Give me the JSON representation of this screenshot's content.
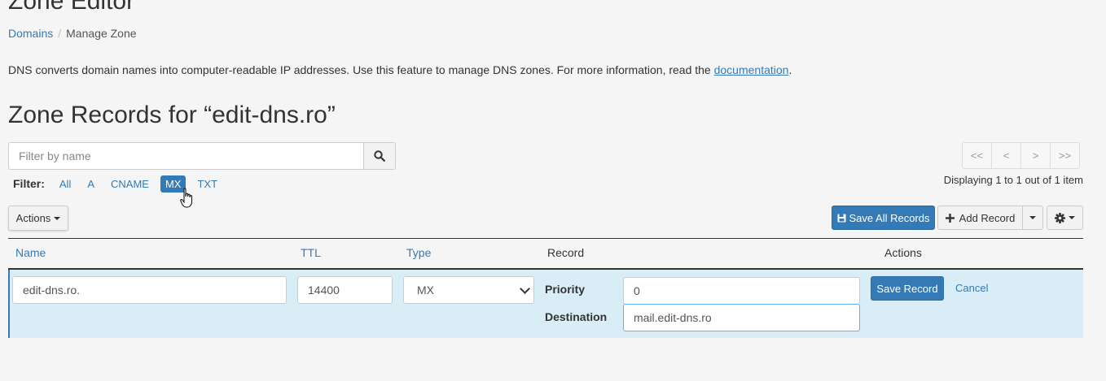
{
  "page": {
    "title": "Zone Editor",
    "breadcrumb": {
      "parent": "Domains",
      "separator": "/",
      "current": "Manage Zone"
    },
    "intro_text": "DNS converts domain names into computer-readable IP addresses. Use this feature to manage DNS zones. For more information, read the ",
    "intro_link": "documentation",
    "intro_end": ".",
    "zone_heading": "Zone Records for “edit-dns.ro”"
  },
  "search": {
    "placeholder": "Filter by name",
    "icon": "search-icon"
  },
  "filter": {
    "label": "Filter:",
    "options": [
      "All",
      "A",
      "CNAME",
      "MX",
      "TXT"
    ],
    "active": "MX"
  },
  "pagination": {
    "first": "<<",
    "prev": "<",
    "next": ">",
    "last": ">>",
    "info": "Displaying 1 to 1 out of 1 item"
  },
  "toolbar": {
    "actions_label": "Actions",
    "save_all_label": "Save All Records",
    "add_record_label": "Add Record"
  },
  "table": {
    "headers": {
      "name": "Name",
      "ttl": "TTL",
      "type": "Type",
      "record": "Record",
      "actions": "Actions"
    }
  },
  "edit_row": {
    "name": "edit-dns.ro.",
    "ttl": "14400",
    "type": "MX",
    "priority_label": "Priority",
    "priority": "0",
    "destination_label": "Destination",
    "destination": "mail.edit-dns.ro",
    "save_label": "Save Record",
    "cancel_label": "Cancel"
  },
  "colors": {
    "accent": "#337ab7",
    "row_highlight": "#d9edf7",
    "background": "#f5f5f5"
  }
}
